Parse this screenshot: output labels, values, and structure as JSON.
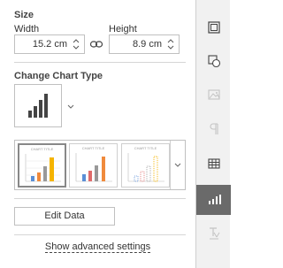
{
  "size": {
    "title": "Size",
    "width_label": "Width",
    "width_value": "15.2 cm",
    "height_label": "Height",
    "height_value": "8.9 cm"
  },
  "chart_type": {
    "title": "Change Chart Type",
    "current": "column-chart-icon"
  },
  "gallery": {
    "items": [
      {
        "title": "CHART TITLE",
        "selected": true
      },
      {
        "title": "CHART TITLE",
        "selected": false
      },
      {
        "title": "CHART TITLE",
        "selected": false
      }
    ]
  },
  "edit_data_label": "Edit Data",
  "advanced_label": "Show advanced settings",
  "rail": {
    "icons": [
      "table-settings-icon",
      "shape-settings-icon",
      "image-settings-icon",
      "paragraph-settings-icon",
      "table-icon",
      "chart-settings-icon",
      "text-art-icon"
    ],
    "active": "chart-settings-icon"
  },
  "colors": {
    "accent_yellow": "#f5b400",
    "bar_blue": "#5b8fd6",
    "bar_gray": "#999999",
    "bar_orange": "#f08a3c",
    "bar_red": "#e06b6b",
    "active_rail": "#6a6a6a"
  }
}
